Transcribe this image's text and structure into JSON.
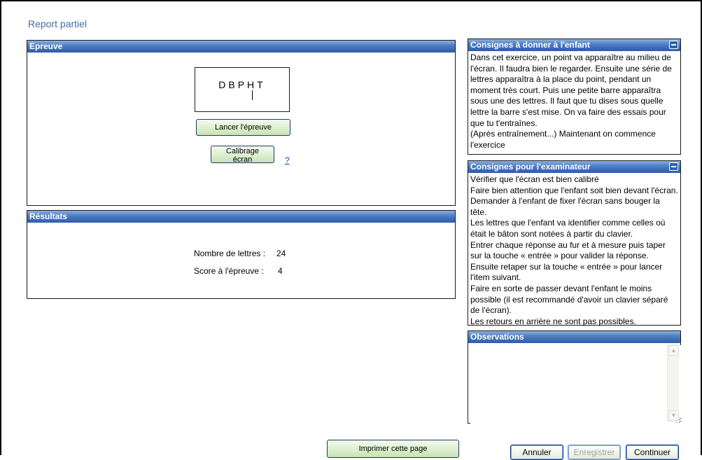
{
  "page": {
    "title": "Report partiel"
  },
  "epreuve": {
    "header": "Epreuve",
    "stimulus_letters": "DBPHT",
    "launch_button": "Lancer l'épreuve",
    "calibration_button": "Calibrage écran",
    "help_link": "?"
  },
  "resultats": {
    "header": "Résultats",
    "letters_label": "Nombre de lettres :",
    "letters_value": "24",
    "score_label": "Score à l'épreuve :",
    "score_value": "4"
  },
  "consignes_enfant": {
    "header": "Consignes à donner à l'enfant",
    "text": "Dans cet exercice, un point va apparaître au milieu de l'écran. Il faudra bien le regarder. Ensuite une série de lettres apparaîtra à la place du point, pendant un moment très court. Puis une petite barre apparaîtra sous une des lettres. Il faut que tu dises sous quelle lettre la barre s'est mise. On va faire des essais pour que tu t'entraînes.\n(Après entraînement...) Maintenant on commence l'exercice"
  },
  "consignes_examinateur": {
    "header": "Consignes pour l'examinateur",
    "lines": [
      "Vérifier que l'écran est bien calibré",
      "Faire bien attention que l'enfant soit bien devant l'écran. Demander à l'enfant de fixer l'écran sans bouger la tête.",
      "Les lettres que l'enfant va identifier comme celles où était le bâton sont notées à partir du clavier.",
      "Entrer chaque réponse au fur et à mesure puis taper sur la touche « entrée » pour valider la réponse.",
      "Ensuite retaper sur la touche « entrée » pour lancer l'item suivant.",
      "Faire en sorte de passer devant l'enfant le moins possible (il est recommandé d'avoir un clavier séparé de l'écran).",
      "Les retours en arrière ne sont pas possibles."
    ]
  },
  "observations": {
    "header": "Observations",
    "value": ""
  },
  "footer": {
    "print_button": "Imprimer cette page",
    "cancel_button": "Annuler",
    "save_button": "Enregistrer",
    "continue_button": "Continuer"
  }
}
